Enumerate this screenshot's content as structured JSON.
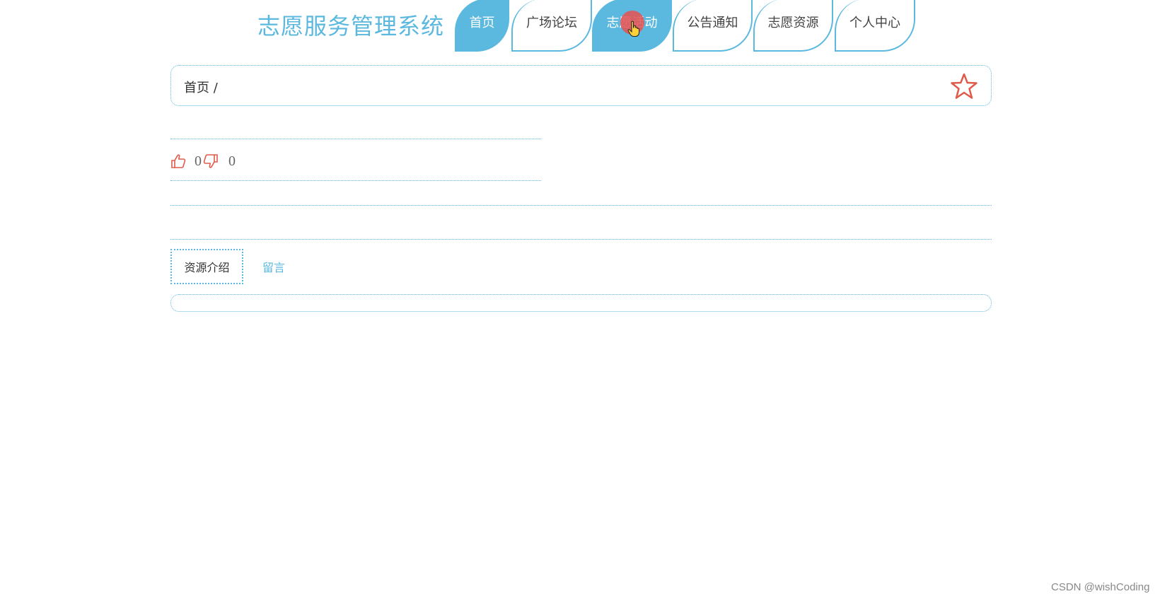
{
  "header": {
    "site_title": "志愿服务管理系统"
  },
  "nav": {
    "tabs": [
      {
        "label": "首页",
        "active": true
      },
      {
        "label": "广场论坛",
        "active": false
      },
      {
        "label": "志愿活动",
        "active": true
      },
      {
        "label": "公告通知",
        "active": false
      },
      {
        "label": "志愿资源",
        "active": false
      },
      {
        "label": "个人中心",
        "active": false
      }
    ]
  },
  "breadcrumb": {
    "text": "首页 /"
  },
  "votes": {
    "like_count": "0",
    "dislike_count": "0"
  },
  "detail_tabs": {
    "intro_label": "资源介绍",
    "comment_label": "留言"
  },
  "watermark": "CSDN @wishCoding",
  "colors": {
    "accent": "#5bb8de",
    "icon_red": "#e05a4a",
    "text": "#333333"
  },
  "icons": {
    "favorite": "star-icon",
    "like": "thumbs-up-icon",
    "dislike": "thumbs-down-icon"
  }
}
